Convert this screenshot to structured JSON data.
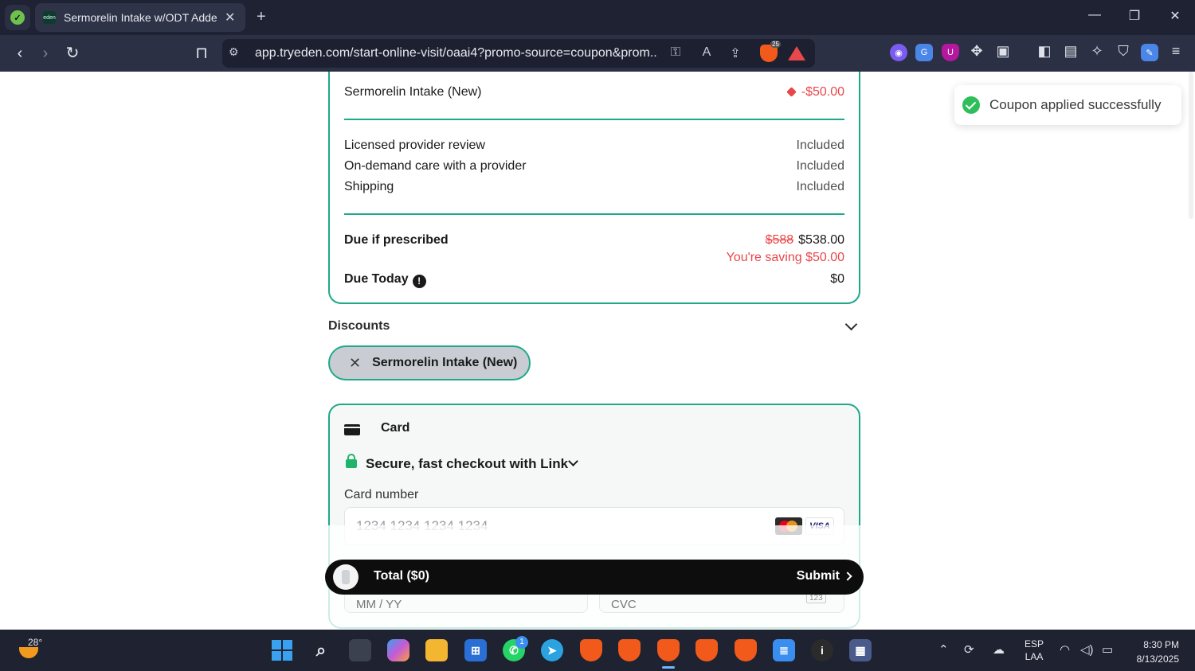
{
  "browser": {
    "tab_title": "Sermorelin Intake w/ODT Added",
    "tab_favicon_text": "eden",
    "new_tab": "+",
    "url": "app.tryeden.com/start-online-visit/oaai4?promo-source=coupon&prom...",
    "shields_count": "25",
    "extensions": [
      "fingerprint",
      "translate",
      "ublock",
      "puzzle",
      "screenshot"
    ]
  },
  "order_summary": {
    "discount_line": {
      "label": "Sermorelin Intake (New)",
      "value": "-$50.00"
    },
    "included_items": [
      {
        "label": "Licensed provider review",
        "value": "Included"
      },
      {
        "label": "On-demand care with a provider",
        "value": "Included"
      },
      {
        "label": "Shipping",
        "value": "Included"
      }
    ],
    "due_if_prescribed": {
      "label": "Due if prescribed",
      "original": "$588",
      "price": "$538.00",
      "saving": "You're saving $50.00"
    },
    "due_today": {
      "label": "Due Today",
      "value": "$0"
    }
  },
  "discounts": {
    "title": "Discounts",
    "applied_chip": "Sermorelin Intake (New)"
  },
  "payment": {
    "method_label": "Card",
    "link_label": "Secure, fast checkout with Link",
    "card_number_label": "Card number",
    "card_number_placeholder": "1234 1234 1234 1234",
    "card_brands": [
      "mastercard",
      "visa"
    ],
    "visa_text": "VISA",
    "expiry_placeholder": "MM / YY",
    "cvc_placeholder": "CVC",
    "cvc_badge": "123"
  },
  "submit_bar": {
    "total_label": "Total ($0)",
    "submit_label": "Submit"
  },
  "toast": {
    "message": "Coupon applied successfully",
    "status_color": "#2fbf5a"
  },
  "taskbar": {
    "weather_temp": "28°",
    "whatsapp_badge": "1",
    "language": "ESP",
    "keyboard": "LAA",
    "time": "8:30 PM",
    "date": "8/13/2025"
  },
  "colors": {
    "accent": "#1fa88a",
    "discount": "#e8474b",
    "brand_dark": "#0d0d0d"
  }
}
